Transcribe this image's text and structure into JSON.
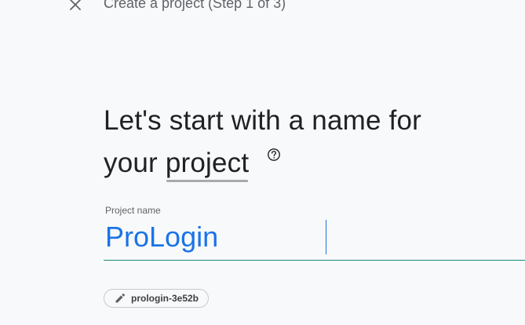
{
  "header": {
    "title": "Create a project (Step 1 of 3)",
    "close_icon": "close-icon"
  },
  "main": {
    "heading_line1": "Let's start with a name for",
    "heading_line2_prefix": "your ",
    "heading_line2_link": "project",
    "help_icon": "help-circle-icon"
  },
  "form": {
    "project_name_label": "Project name",
    "project_name_value": "ProLogin",
    "project_id_chip": "prologin-3e52b",
    "edit_icon": "pencil-icon"
  },
  "colors": {
    "accent": "#1a73e8",
    "field_underline": "#1a8a7a",
    "background": "#f8f9fa"
  }
}
